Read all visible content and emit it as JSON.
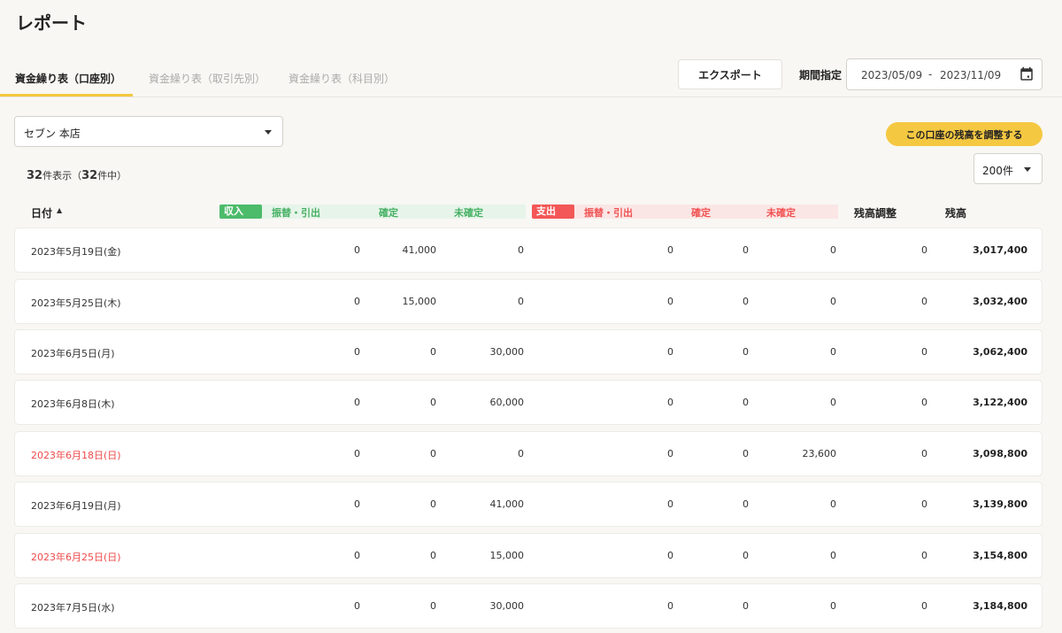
{
  "page_title": "レポート",
  "tabs": [
    {
      "label": "資金繰り表（口座別）",
      "active": true
    },
    {
      "label": "資金繰り表（取引先別）",
      "active": false
    },
    {
      "label": "資金繰り表（科目別）",
      "active": false
    }
  ],
  "toolbar": {
    "export_label": "エクスポート",
    "period_label": "期間指定",
    "date_from": "2023/05/09",
    "date_sep": "-",
    "date_to": "2023/11/09"
  },
  "account_select": {
    "value": "セブン 本店"
  },
  "adjust_button_label": "この口座の残高を調整する",
  "count": {
    "shown": "32",
    "shown_suffix": "件表示（",
    "total": "32",
    "total_suffix": "件中）"
  },
  "per_page": {
    "value": "200件"
  },
  "table": {
    "headers": {
      "date": "日付",
      "sort_indicator": "▲",
      "income_badge": "収入",
      "income_transfer": "振替・引出",
      "income_confirmed": "確定",
      "income_unconfirmed": "未確定",
      "expense_badge": "支出",
      "expense_transfer": "振替・引出",
      "expense_confirmed": "確定",
      "expense_unconfirmed": "未確定",
      "adjustment": "残高調整",
      "balance": "残高"
    },
    "rows": [
      {
        "date": "2023年5月19日(金)",
        "holiday": false,
        "in_transfer": "0",
        "in_confirmed": "41,000",
        "in_unconfirmed": "0",
        "out_transfer": "0",
        "out_confirmed": "0",
        "out_unconfirmed": "0",
        "adjustment": "0",
        "balance": "3,017,400"
      },
      {
        "date": "2023年5月25日(木)",
        "holiday": false,
        "in_transfer": "0",
        "in_confirmed": "15,000",
        "in_unconfirmed": "0",
        "out_transfer": "0",
        "out_confirmed": "0",
        "out_unconfirmed": "0",
        "adjustment": "0",
        "balance": "3,032,400"
      },
      {
        "date": "2023年6月5日(月)",
        "holiday": false,
        "in_transfer": "0",
        "in_confirmed": "0",
        "in_unconfirmed": "30,000",
        "out_transfer": "0",
        "out_confirmed": "0",
        "out_unconfirmed": "0",
        "adjustment": "0",
        "balance": "3,062,400"
      },
      {
        "date": "2023年6月8日(木)",
        "holiday": false,
        "in_transfer": "0",
        "in_confirmed": "0",
        "in_unconfirmed": "60,000",
        "out_transfer": "0",
        "out_confirmed": "0",
        "out_unconfirmed": "0",
        "adjustment": "0",
        "balance": "3,122,400"
      },
      {
        "date": "2023年6月18日(日)",
        "holiday": true,
        "in_transfer": "0",
        "in_confirmed": "0",
        "in_unconfirmed": "0",
        "out_transfer": "0",
        "out_confirmed": "0",
        "out_unconfirmed": "23,600",
        "adjustment": "0",
        "balance": "3,098,800"
      },
      {
        "date": "2023年6月19日(月)",
        "holiday": false,
        "in_transfer": "0",
        "in_confirmed": "0",
        "in_unconfirmed": "41,000",
        "out_transfer": "0",
        "out_confirmed": "0",
        "out_unconfirmed": "0",
        "adjustment": "0",
        "balance": "3,139,800"
      },
      {
        "date": "2023年6月25日(日)",
        "holiday": true,
        "in_transfer": "0",
        "in_confirmed": "0",
        "in_unconfirmed": "15,000",
        "out_transfer": "0",
        "out_confirmed": "0",
        "out_unconfirmed": "0",
        "adjustment": "0",
        "balance": "3,154,800"
      },
      {
        "date": "2023年7月5日(水)",
        "holiday": false,
        "in_transfer": "0",
        "in_confirmed": "0",
        "in_unconfirmed": "30,000",
        "out_transfer": "0",
        "out_confirmed": "0",
        "out_unconfirmed": "0",
        "adjustment": "0",
        "balance": "3,184,800"
      }
    ]
  },
  "colors": {
    "accent": "#f5c842",
    "income": "#4cbb6a",
    "expense": "#f35757",
    "holiday": "#ef4a4a"
  }
}
